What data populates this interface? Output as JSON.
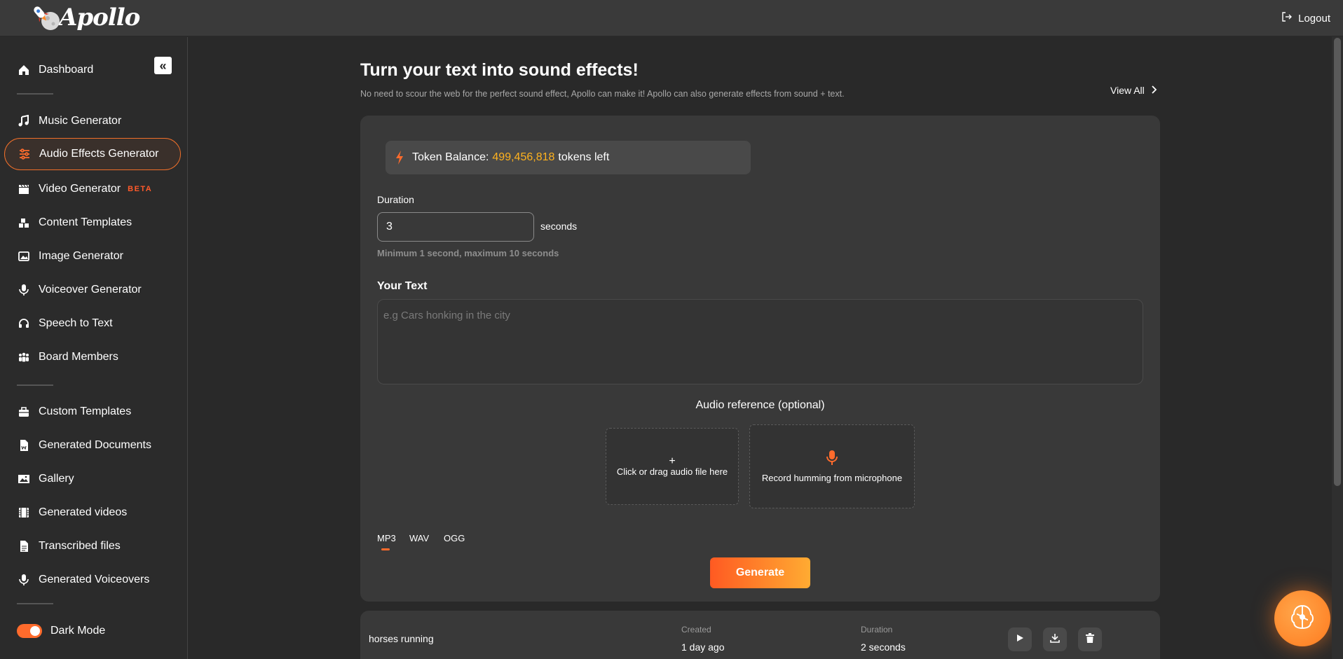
{
  "app": {
    "name": "Apollo"
  },
  "header": {
    "logout_label": "Logout"
  },
  "sidebar": {
    "collapse_glyph": "«",
    "dashboard": {
      "label": "Dashboard",
      "icon": "home-icon"
    },
    "groups": [
      {
        "label": "Music Generator",
        "icon": "music-note-icon"
      },
      {
        "label": "Audio Effects Generator",
        "icon": "sliders-icon",
        "active": true
      },
      {
        "label": "Video Generator",
        "icon": "clapperboard-icon",
        "badge": "BETA"
      },
      {
        "label": "Content Templates",
        "icon": "blocks-icon"
      },
      {
        "label": "Image Generator",
        "icon": "image-icon"
      },
      {
        "label": "Voiceover Generator",
        "icon": "microphone-icon"
      },
      {
        "label": "Speech to Text",
        "icon": "headset-icon"
      },
      {
        "label": "Board Members",
        "icon": "people-icon"
      }
    ],
    "library": [
      {
        "label": "Custom Templates",
        "icon": "toolbox-icon"
      },
      {
        "label": "Generated Documents",
        "icon": "document-icon"
      },
      {
        "label": "Gallery",
        "icon": "picture-icon"
      },
      {
        "label": "Generated videos",
        "icon": "film-icon"
      },
      {
        "label": "Transcribed files",
        "icon": "file-text-icon"
      },
      {
        "label": "Generated Voiceovers",
        "icon": "microphone-icon"
      }
    ],
    "dark_mode": {
      "label": "Dark Mode",
      "enabled": true
    }
  },
  "main": {
    "title": "Turn your text into sound effects!",
    "subtitle": "No need to scour the web for the perfect sound effect, Apollo can make it! Apollo can also generate effects from sound + text.",
    "view_all_label": "View All",
    "token": {
      "prefix": "Token Balance:",
      "amount": "499,456,818",
      "suffix": "tokens left"
    },
    "duration": {
      "label": "Duration",
      "value": "3",
      "unit": "seconds",
      "hint": "Minimum 1 second, maximum 10 seconds"
    },
    "text": {
      "label": "Your Text",
      "placeholder": "e.g Cars honking in the city"
    },
    "audio_reference": {
      "label": "Audio reference (optional)",
      "upload_plus": "+",
      "upload_label": "Click or drag audio file here",
      "record_label": "Record humming from microphone"
    },
    "formats": [
      "MP3",
      "WAV",
      "OGG"
    ],
    "selected_format": "MP3",
    "generate_label": "Generate"
  },
  "history": [
    {
      "title": "horses running",
      "created_key": "Created",
      "created": "1 day ago",
      "duration_key": "Duration",
      "duration": "2 seconds"
    }
  ],
  "colors": {
    "accent": "#ff6b2c",
    "token_amount": "#ffb21e",
    "background": "#292929",
    "card": "#393939"
  }
}
